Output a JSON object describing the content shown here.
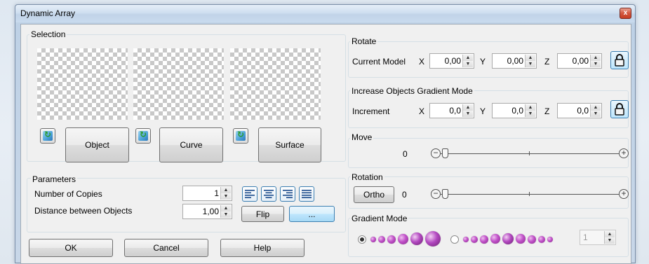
{
  "window": {
    "title": "Dynamic Array",
    "close_glyph": "x"
  },
  "selection": {
    "label": "Selection",
    "object_label": "Object",
    "curve_label": "Curve",
    "surface_label": "Surface"
  },
  "parameters": {
    "label": "Parameters",
    "copies_label": "Number of Copies",
    "copies_value": "1",
    "distance_label": "Distance between Objects",
    "distance_value": "1,00",
    "flip_label": "Flip",
    "more_label": "..."
  },
  "rotate": {
    "label": "Rotate",
    "mode_label": "Current Model",
    "x_label": "X",
    "x_value": "0,00",
    "y_label": "Y",
    "y_value": "0,00",
    "z_label": "Z",
    "z_value": "0,00"
  },
  "increase": {
    "label": "Increase Objects Gradient Mode",
    "increment_label": "Increment",
    "x_label": "X",
    "x_value": "0,0",
    "y_label": "Y",
    "y_value": "0,0",
    "z_label": "Z",
    "z_value": "0,0"
  },
  "move": {
    "label": "Move",
    "value": "0",
    "minus": "−",
    "plus": "+"
  },
  "rotation": {
    "label": "Rotation",
    "ortho_label": "Ortho",
    "value": "0",
    "minus": "−",
    "plus": "+"
  },
  "gradient": {
    "label": "Gradient Mode",
    "option1_selected": true,
    "count_value": "1"
  },
  "footer": {
    "ok_label": "OK",
    "cancel_label": "Cancel",
    "help_label": "Help"
  },
  "colors": {
    "accent": "#3c7fb1",
    "dot": "#c050c8"
  }
}
